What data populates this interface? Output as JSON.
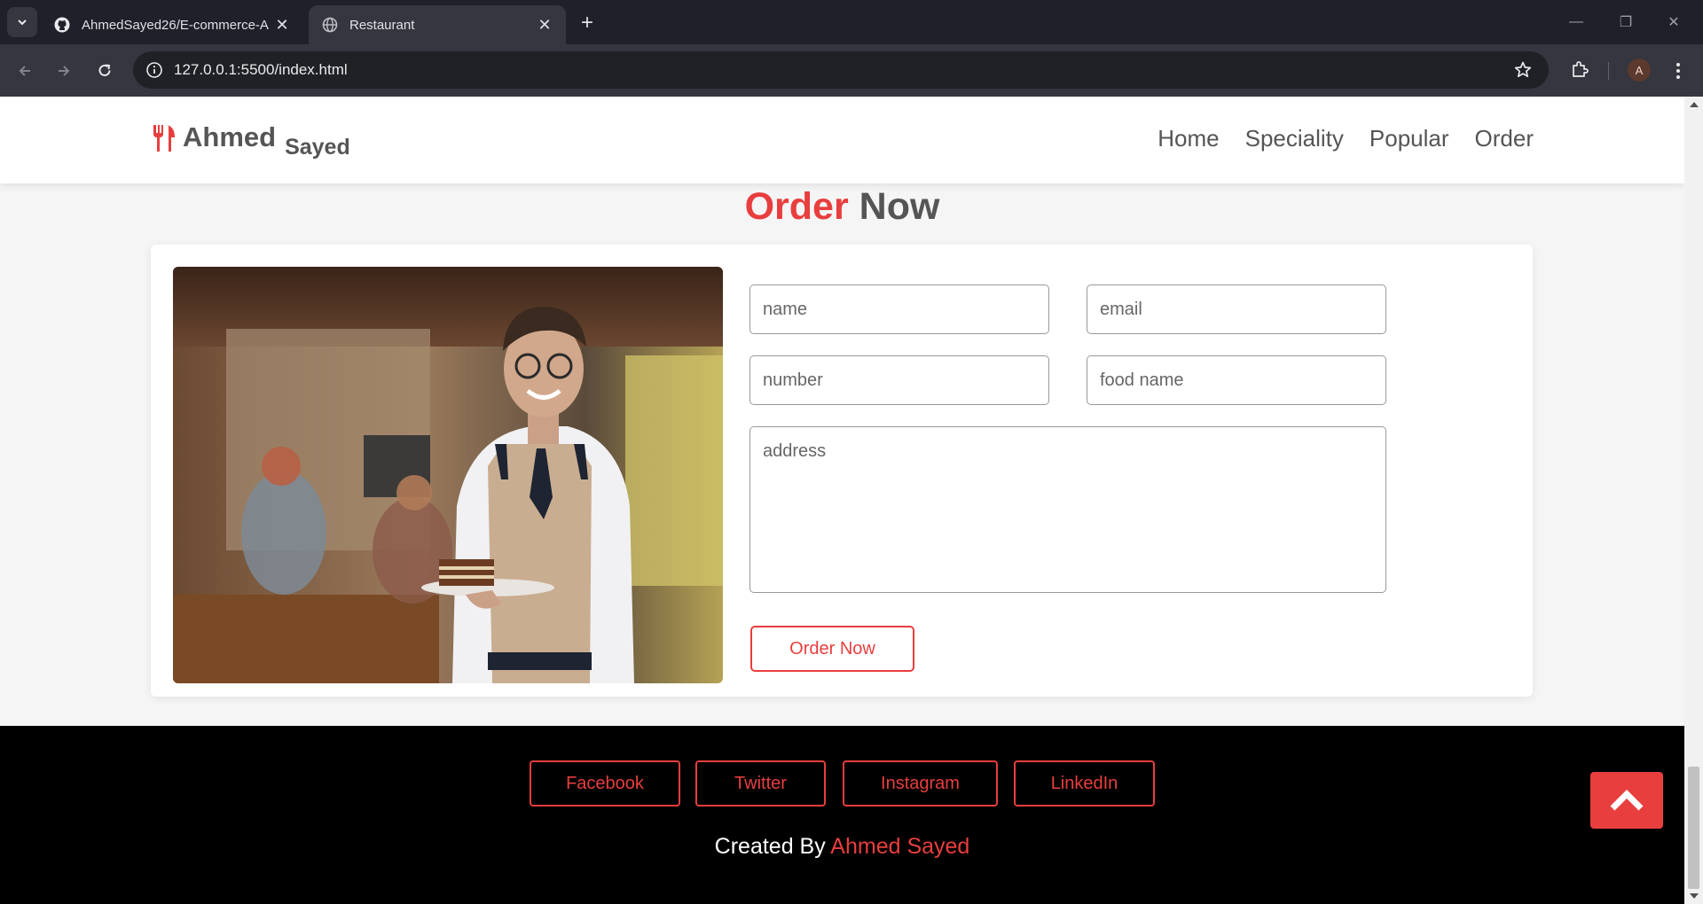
{
  "browser": {
    "tabs": [
      {
        "title": "AhmedSayed26/E-commerce-A",
        "icon": "github-icon",
        "active": false
      },
      {
        "title": "Restaurant",
        "icon": "globe-icon",
        "active": true
      }
    ],
    "new_tab_label": "+",
    "url": "127.0.0.1:5500/index.html",
    "profile_initial": "A",
    "window_controls": {
      "minimize": "—",
      "restore": "❐",
      "close": "✕"
    }
  },
  "header": {
    "logo": {
      "first": "Ahmed",
      "last": "Sayed",
      "icon": "utensils-icon"
    },
    "nav": [
      "Home",
      "Speciality",
      "Popular",
      "Order"
    ]
  },
  "order_section": {
    "title_highlight": "Order",
    "title_rest": "Now",
    "image_alt": "waiter holding a plate of cake",
    "form": {
      "name_placeholder": "name",
      "email_placeholder": "email",
      "number_placeholder": "number",
      "food_placeholder": "food name",
      "address_placeholder": "address",
      "submit_label": "Order Now"
    }
  },
  "footer": {
    "social_links": [
      "Facebook",
      "Twitter",
      "Instagram",
      "LinkedIn"
    ],
    "credit_prefix": "Created By",
    "credit_name": "Ahmed Sayed"
  },
  "colors": {
    "accent": "#e83e3e",
    "text": "#555555",
    "footer_bg": "#000000",
    "chrome_bg": "#35363f"
  }
}
